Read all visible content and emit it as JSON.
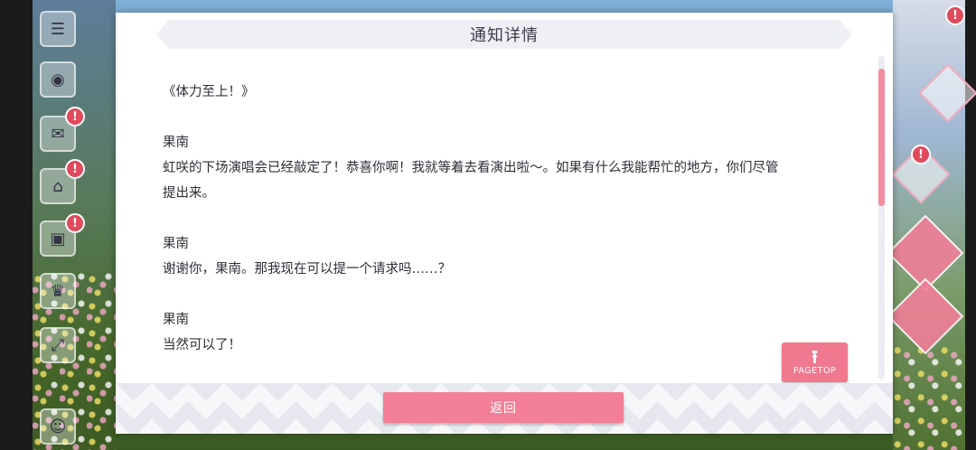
{
  "dialog": {
    "title": "通知详情",
    "story_title": "《体力至上！》",
    "blocks": [
      {
        "speaker": "果南",
        "line": "虹咲的下场演唱会已经敲定了！恭喜你啊！我就等着去看演出啦～。如果有什么我能帮忙的地方，你们尽管",
        "line2": "提出来。"
      },
      {
        "speaker": "果南",
        "line": "谢谢你，果南。那我现在可以提一个请求吗……？"
      },
      {
        "speaker": "果南",
        "line": "当然可以了！"
      }
    ],
    "pagetop_label": "PAGETOP",
    "back_label": "返回"
  },
  "background": {
    "badge_glyph": "!"
  },
  "colors": {
    "accent_pink": "#f27f95",
    "scroll_thumb": "#f28ca0",
    "title_bg": "#eef0f6"
  }
}
